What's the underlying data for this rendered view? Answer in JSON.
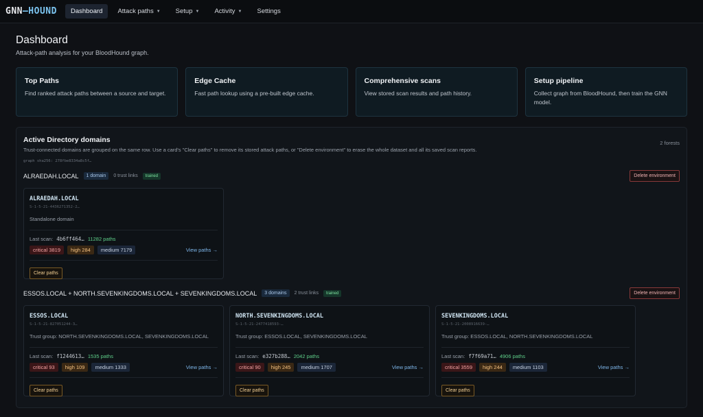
{
  "app": {
    "logo_left": "GNN",
    "logo_right": "—HOUND"
  },
  "nav": [
    {
      "label": "Dashboard",
      "active": true,
      "caret": false
    },
    {
      "label": "Attack paths",
      "active": false,
      "caret": true
    },
    {
      "label": "Setup",
      "active": false,
      "caret": true
    },
    {
      "label": "Activity",
      "active": false,
      "caret": true
    },
    {
      "label": "Settings",
      "active": false,
      "caret": false
    }
  ],
  "page": {
    "title": "Dashboard",
    "subtitle": "Attack-path analysis for your BloodHound graph."
  },
  "cards": [
    {
      "title": "Top Paths",
      "desc": "Find ranked attack paths between a source and target."
    },
    {
      "title": "Edge Cache",
      "desc": "Fast path lookup using a pre-built edge cache."
    },
    {
      "title": "Comprehensive scans",
      "desc": "View stored scan results and path history."
    },
    {
      "title": "Setup pipeline",
      "desc": "Collect graph from BloodHound, then train the GNN model."
    }
  ],
  "panel": {
    "title": "Active Directory domains",
    "desc": "Trust-connected domains are grouped on the same row. Use a card's \"Clear paths\" to remove its stored attack paths, or \"Delete environment\" to erase the whole dataset and all its saved scan reports.",
    "forests": "2 forests",
    "hash": "graph sha256: 278fbe8334a8c5f…"
  },
  "environments": [
    {
      "name": "ALRAEDAH.LOCAL",
      "domains_badge": "1 domain",
      "trust": "0 trust links",
      "status": "trained",
      "delete_label": "Delete environment",
      "domains": [
        {
          "name": "ALRAEDAH.LOCAL",
          "sid": "S-1-5-21-4436271352-2…",
          "trust": "Standalone domain",
          "scan_label": "Last scan:",
          "scan_hash": "4b6ff464…",
          "paths": "11282 paths",
          "critical": "critical 3819",
          "high": "high 284",
          "medium": "medium 7179",
          "view": "View paths →",
          "clear": "Clear paths"
        }
      ]
    },
    {
      "name": "ESSOS.LOCAL + NORTH.SEVENKINGDOMS.LOCAL + SEVENKINGDOMS.LOCAL",
      "domains_badge": "3 domains",
      "trust": "2 trust links",
      "status": "trained",
      "delete_label": "Delete environment",
      "domains": [
        {
          "name": "ESSOS.LOCAL",
          "sid": "S-1-5-21-827051244-3…",
          "trust": "Trust group: NORTH.SEVENKINGDOMS.LOCAL, SEVENKINGDOMS.LOCAL",
          "scan_label": "Last scan:",
          "scan_hash": "f1244613…",
          "paths": "1535 paths",
          "critical": "critical 93",
          "high": "high 109",
          "medium": "medium 1333",
          "view": "View paths →",
          "clear": "Clear paths"
        },
        {
          "name": "NORTH.SEVENKINGDOMS.LOCAL",
          "sid": "S-1-5-21-2477418593-…",
          "trust": "Trust group: ESSOS.LOCAL, SEVENKINGDOMS.LOCAL",
          "scan_label": "Last scan:",
          "scan_hash": "e327b288…",
          "paths": "2042 paths",
          "critical": "critical 90",
          "high": "high 245",
          "medium": "medium 1707",
          "view": "View paths →",
          "clear": "Clear paths"
        },
        {
          "name": "SEVENKINGDOMS.LOCAL",
          "sid": "S-1-5-21-2008916639-…",
          "trust": "Trust group: ESSOS.LOCAL, NORTH.SEVENKINGDOMS.LOCAL",
          "scan_label": "Last scan:",
          "scan_hash": "f7f69a71…",
          "paths": "4906 paths",
          "critical": "critical 3559",
          "high": "high 244",
          "medium": "medium 1103",
          "view": "View paths →",
          "clear": "Clear paths"
        }
      ]
    }
  ]
}
